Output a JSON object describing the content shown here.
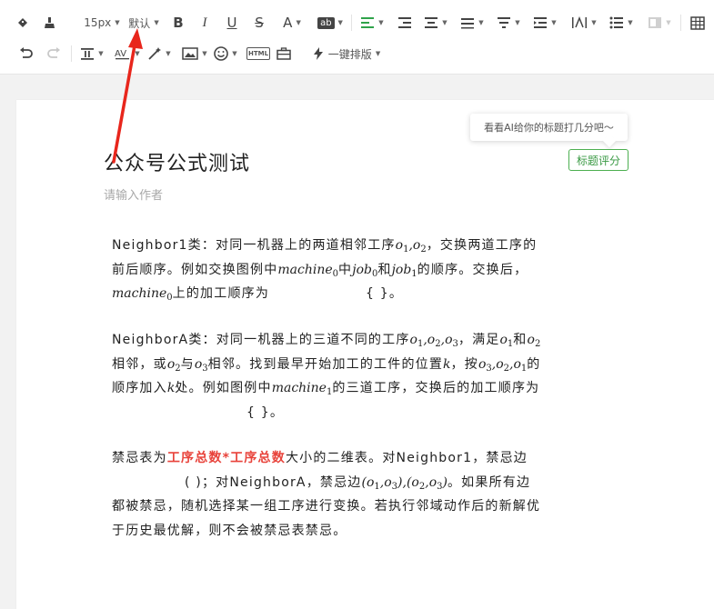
{
  "toolbar": {
    "font_size": "15px",
    "font_family": "默认",
    "bold": "B",
    "italic": "I",
    "underline": "U",
    "strike": "S",
    "font_color": "A",
    "bg_color": "ab",
    "html_label": "HTML",
    "one_key_format": "一键排版"
  },
  "editor": {
    "title": "公众号公式测试",
    "author_placeholder": "请输入作者",
    "tooltip": "看看AI给你的标题打几分吧～",
    "score_button": "标题评分"
  },
  "content": {
    "p1": {
      "a": "Neighbor1类：对同一机器上的两道相邻工序",
      "m_o1": "o",
      "s1": "1",
      "comma": ",",
      "m_o2": "o",
      "s2": "2",
      "b": "，交换两道工序的",
      "c": "前后顺序。例如交换图例中",
      "m_machine": "machine",
      "s0": "0",
      "d": "中",
      "m_job": "job",
      "sj0": "0",
      "e": "和",
      "m_job2": "job",
      "sj1": "1",
      "f": "的顺序。交换后，",
      "m_machine2": "machine",
      "s02": "0",
      "g": "上的加工顺序为",
      "h": "{  }。"
    },
    "p2": {
      "a": "NeighborA类：对同一机器上的三道不同的工序",
      "math1": "o",
      "s1": "1",
      "math2": "o",
      "s2": "2",
      "math3": "o",
      "s3": "3",
      "b": "，满足",
      "m4": "o",
      "s4": "1",
      "c": "和",
      "m5": "o",
      "s5": "2",
      "d": "相邻，或",
      "m6": "o",
      "s6": "2",
      "e": "与",
      "m7": "o",
      "s7": "3",
      "f": "相邻。找到最早开始加工的工件的位置",
      "m_k": "k",
      "g": "，按",
      "m8": "o",
      "s8": "3",
      "m9": "o",
      "s9": "2",
      "m10": "o",
      "s10": "1",
      "h": "的",
      "i": "顺序加入",
      "m_k2": "k",
      "j": "处。例如图例中",
      "m_machine": "machine",
      "sm1": "1",
      "k": "的三道工序，交换后的加工顺序为",
      "l": "{  }。"
    },
    "p3": {
      "a": "禁忌表为",
      "red1": "工序总数*工序总数",
      "b": "大小的二维表。对Neighbor1，禁忌边",
      "c": "(  )；对NeighborA，禁忌边",
      "pair1_o1": "o",
      "pair1_s1": "1",
      "pair1_o2": "o",
      "pair1_s2": "3",
      "pair2_o1": "o",
      "pair2_s1": "2",
      "pair2_o2": "o",
      "pair2_s2": "3",
      "d": "。如果所有边",
      "e": "都被禁忌，随机选择某一组工序进行变换。若执行邻域动作后的新解优",
      "f": "于历史最优解，则不会被禁忌表禁忌。"
    }
  },
  "colors": {
    "accent_green": "#2fa34a",
    "highlight_red": "#e8433b",
    "arrow_red": "#e8261c"
  }
}
